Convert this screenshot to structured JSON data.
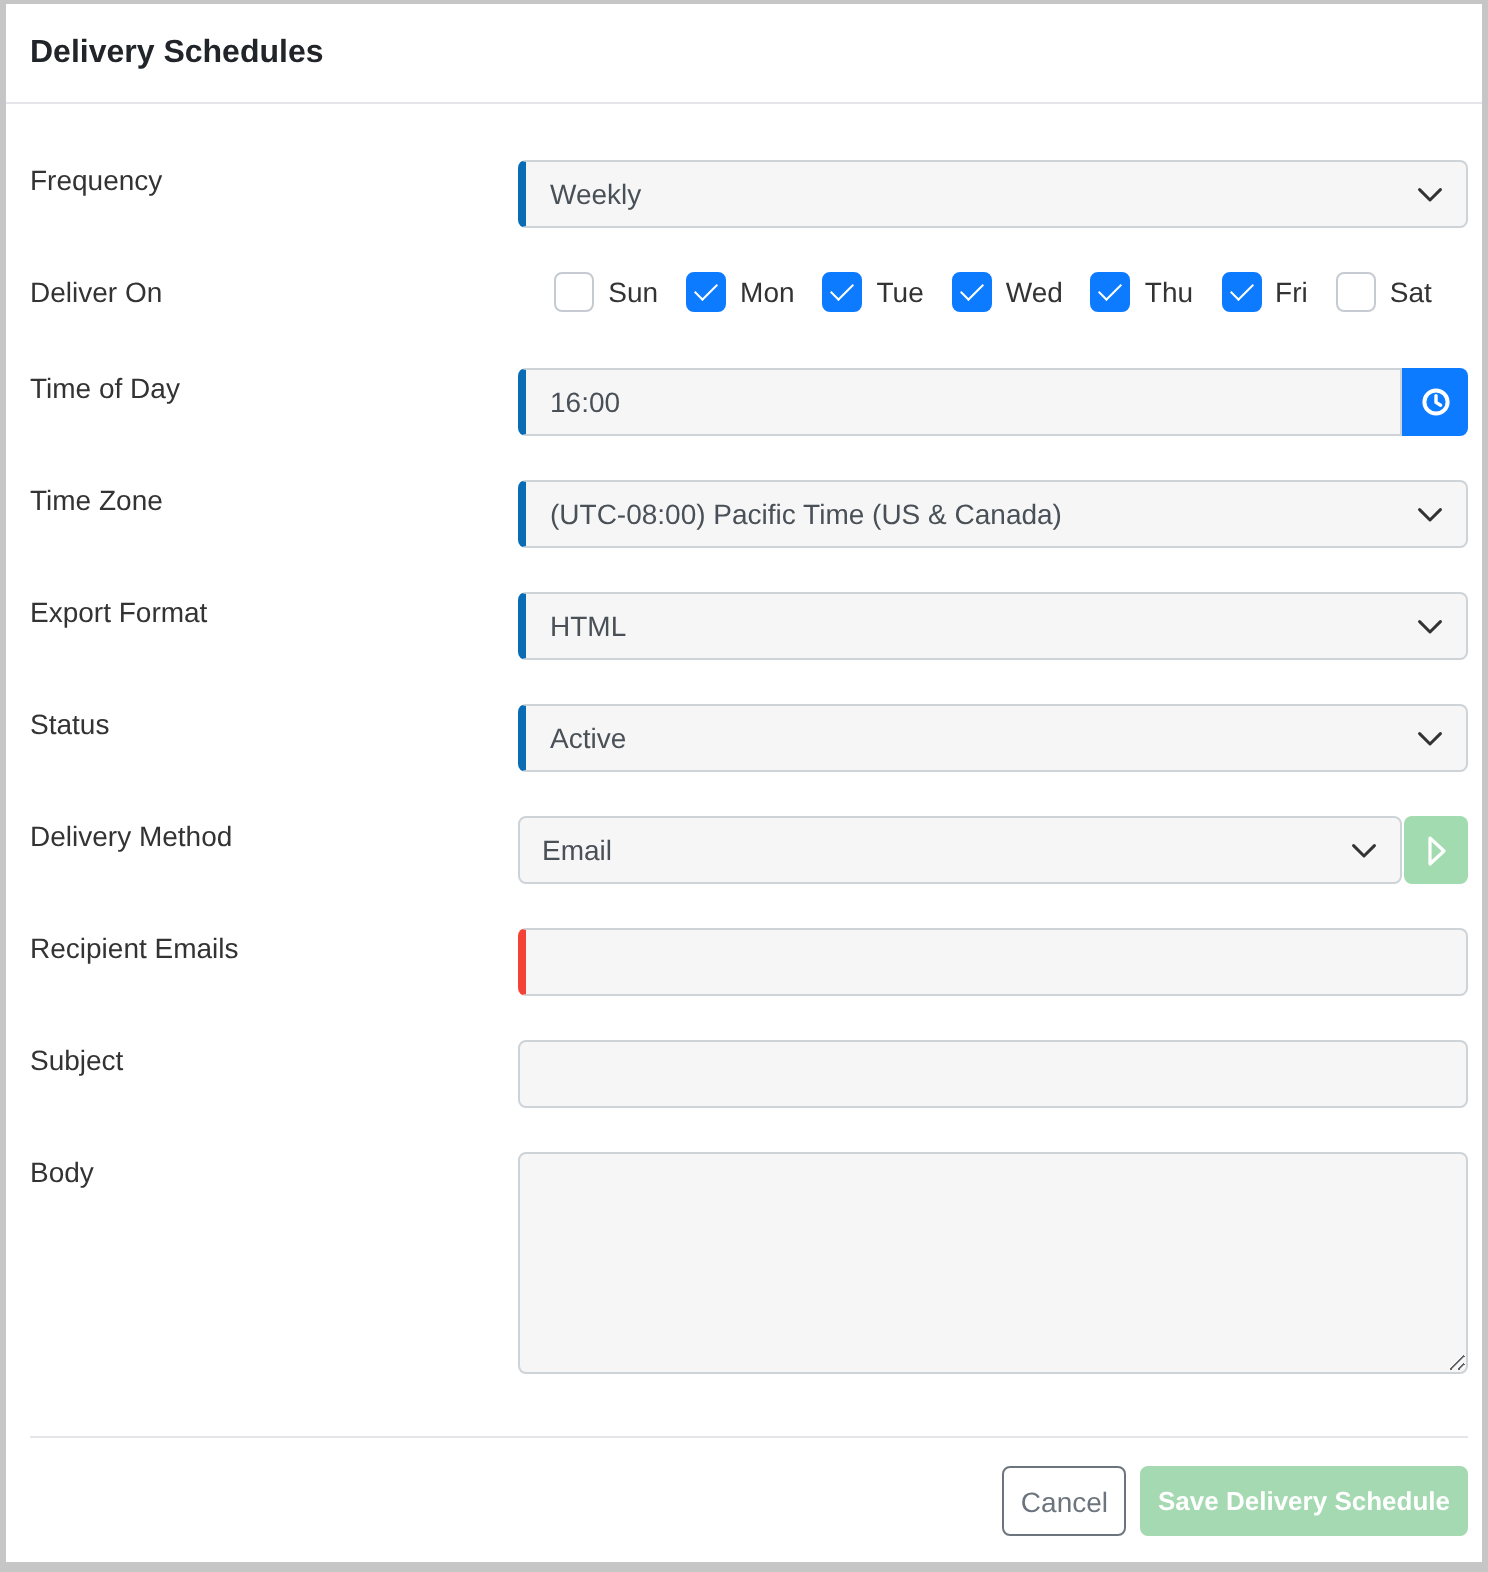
{
  "dialog": {
    "title": "Delivery Schedules"
  },
  "fields": [
    {
      "kind": "select",
      "label": "Frequency",
      "value": "Weekly",
      "required": true,
      "invalid": false
    },
    {
      "kind": "days",
      "label": "Deliver On",
      "days": [
        {
          "label": "Sun",
          "checked": false
        },
        {
          "label": "Mon",
          "checked": true
        },
        {
          "label": "Tue",
          "checked": true
        },
        {
          "label": "Wed",
          "checked": true
        },
        {
          "label": "Thu",
          "checked": true
        },
        {
          "label": "Fri",
          "checked": true
        },
        {
          "label": "Sat",
          "checked": false
        }
      ]
    },
    {
      "kind": "time",
      "label": "Time of Day",
      "value": "16:00",
      "required": true,
      "invalid": false
    },
    {
      "kind": "select",
      "label": "Time Zone",
      "value": "(UTC-08:00) Pacific Time (US & Canada)",
      "required": true,
      "invalid": false
    },
    {
      "kind": "select",
      "label": "Export Format",
      "value": "HTML",
      "required": true,
      "invalid": false
    },
    {
      "kind": "select",
      "label": "Status",
      "value": "Active",
      "required": true,
      "invalid": false
    },
    {
      "kind": "select",
      "label": "Delivery Method",
      "value": "Email",
      "required": false,
      "invalid": false,
      "action": {
        "disabled": true
      }
    },
    {
      "kind": "text",
      "label": "Recipient Emails",
      "required": true,
      "invalid": true
    },
    {
      "kind": "text",
      "label": "Subject",
      "required": false,
      "invalid": false
    },
    {
      "kind": "textarea",
      "label": "Body",
      "required": false,
      "invalid": false
    }
  ],
  "buttons": [
    {
      "kind": "secondary",
      "label": "Cancel",
      "disabled": false
    },
    {
      "kind": "primary",
      "label": "Save Delivery Schedule",
      "disabled": true
    }
  ]
}
